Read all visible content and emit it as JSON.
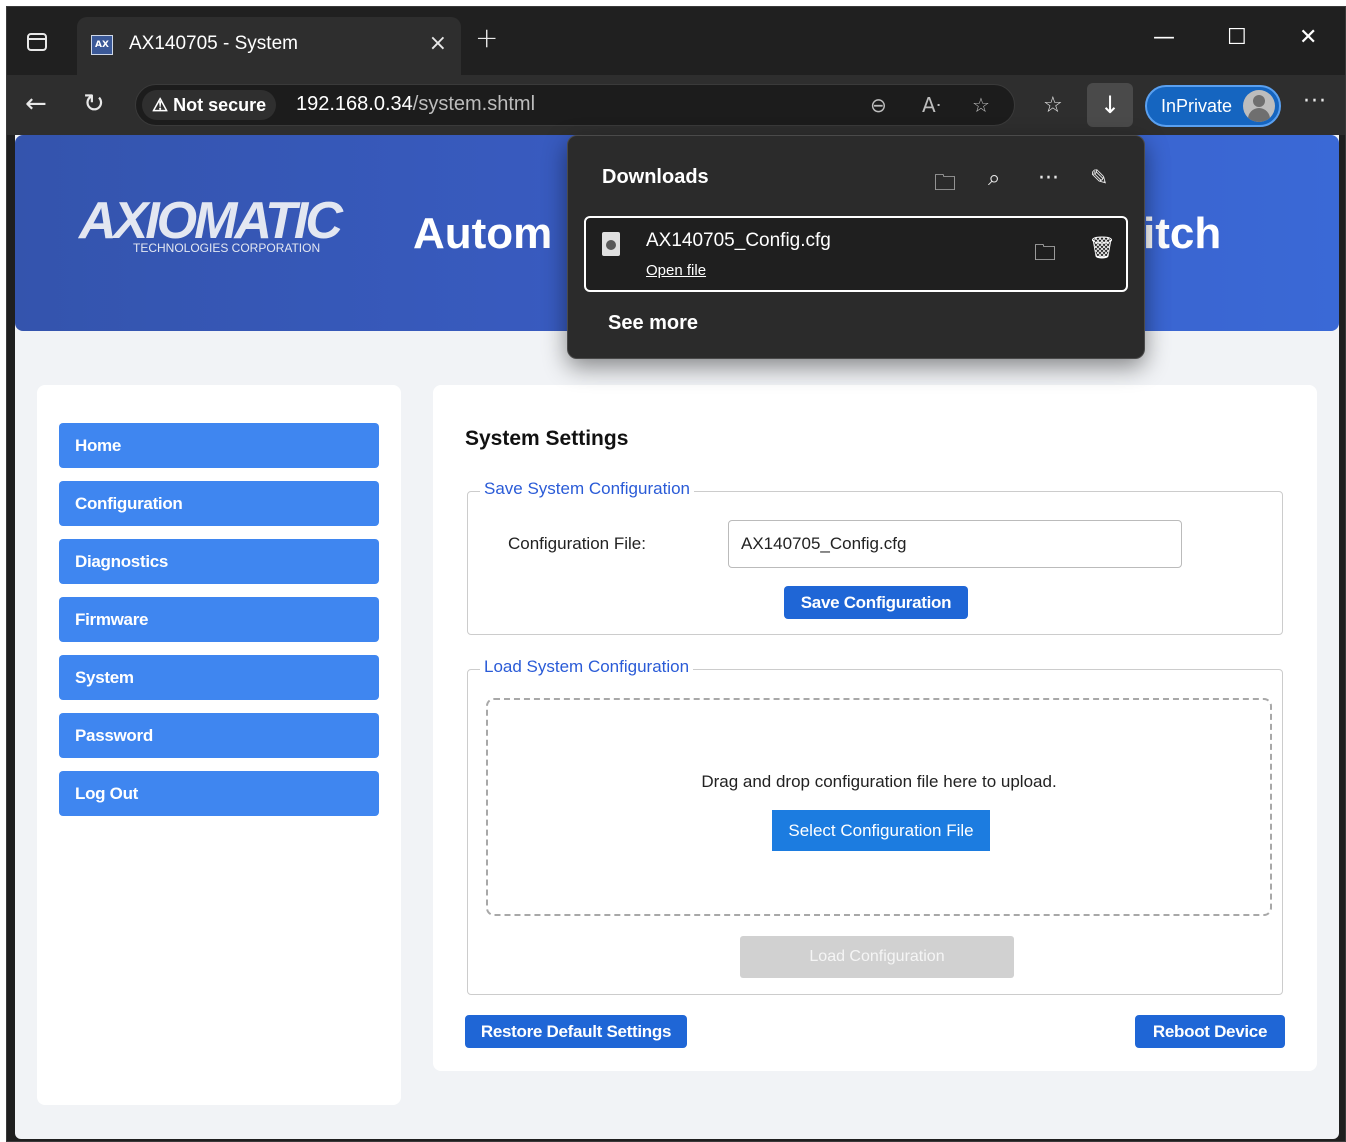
{
  "browser": {
    "tab_title": "AX140705 - System",
    "tab_close": "×",
    "new_tab": "+",
    "security_label": "Not secure",
    "url_host": "192.168.0.34",
    "url_path": "/system.shtml",
    "inprivate_label": "InPrivate",
    "more": "···"
  },
  "banner": {
    "logo_word": "AXIOMATIC",
    "logo_sub": "TECHNOLOGIES CORPORATION",
    "title_left": "Autom",
    "title_right": "itch"
  },
  "sidebar": {
    "items": [
      {
        "label": "Home"
      },
      {
        "label": "Configuration"
      },
      {
        "label": "Diagnostics"
      },
      {
        "label": "Firmware"
      },
      {
        "label": "System"
      },
      {
        "label": "Password"
      },
      {
        "label": "Log Out"
      }
    ]
  },
  "main": {
    "title": "System Settings",
    "save": {
      "legend": "Save System Configuration",
      "field_label": "Configuration File:",
      "field_value": "AX140705_Config.cfg",
      "button": "Save Configuration"
    },
    "load": {
      "legend": "Load System Configuration",
      "drop_text": "Drag and drop configuration file here to upload.",
      "select_button": "Select Configuration File",
      "load_button": "Load Configuration"
    },
    "restore_button": "Restore Default Settings",
    "reboot_button": "Reboot Device"
  },
  "downloads": {
    "title": "Downloads",
    "file_name": "AX140705_Config.cfg",
    "open_file": "Open file",
    "see_more": "See more"
  },
  "colors": {
    "banner": "#3454ad",
    "nav_button": "#3f86f0",
    "primary_button": "#1f66d6",
    "legend_text": "#2a5bd7"
  }
}
